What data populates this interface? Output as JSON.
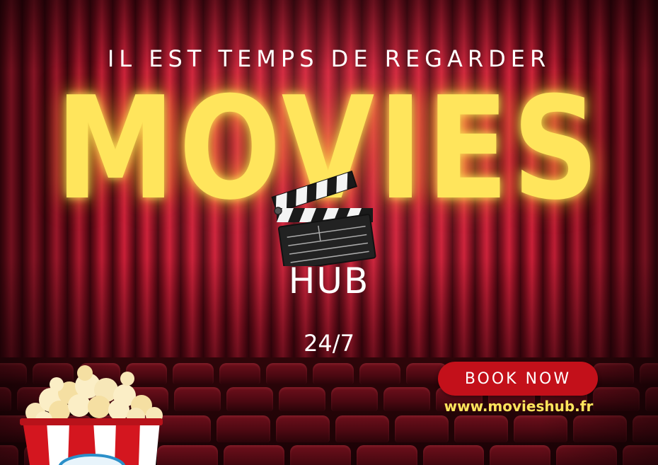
{
  "poster": {
    "tagline": "IL EST TEMPS DE REGARDER",
    "title": "MOVIES",
    "subtitle": "HUB",
    "hours": "24/7",
    "cta_label": "BOOK NOW",
    "website": "www.movieshub.fr"
  },
  "colors": {
    "title_yellow": "#ffe55c",
    "cta_red": "#c3101a",
    "curtain_red": "#b0182e",
    "text_white": "#ffffff"
  },
  "icons": {
    "clapperboard": "clapperboard-icon",
    "popcorn": "popcorn-icon"
  }
}
